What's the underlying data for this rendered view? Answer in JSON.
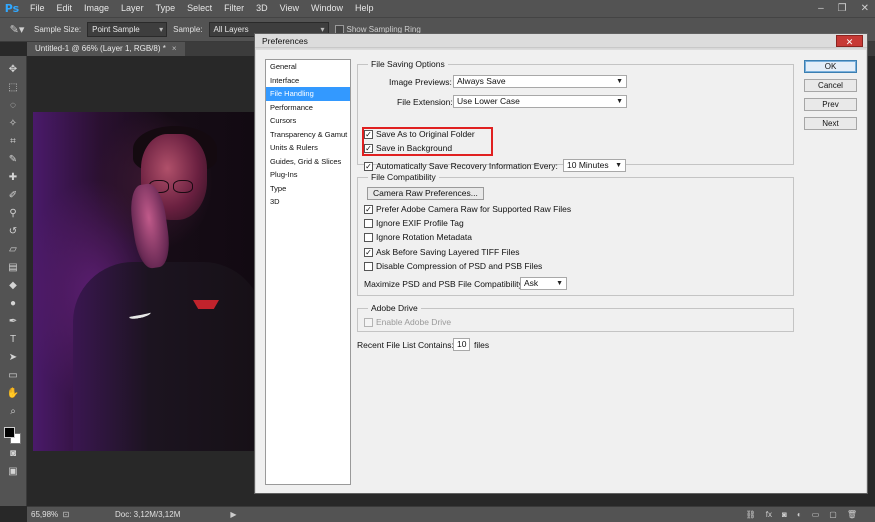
{
  "app": {
    "logo": "Ps",
    "menu": [
      "File",
      "Edit",
      "Image",
      "Layer",
      "Type",
      "Select",
      "Filter",
      "3D",
      "View",
      "Window",
      "Help"
    ],
    "window_controls": [
      "–",
      "❐",
      "✕"
    ]
  },
  "options_bar": {
    "sample_size_label": "Sample Size:",
    "sample_size_value": "Point Sample",
    "sample_label": "Sample:",
    "sample_value": "All Layers",
    "show_ring_label": "Show Sampling Ring"
  },
  "document_tab": {
    "title": "Untitled-1 @ 66% (Layer 1, RGB/8) *",
    "close": "×"
  },
  "status_bar": {
    "zoom": "65,98%",
    "doc_info": "Doc: 3,12M/3,12M",
    "arrow": "▶"
  },
  "preferences": {
    "title": "Preferences",
    "close_glyph": "✕",
    "categories": [
      {
        "label": "General",
        "selected": false
      },
      {
        "label": "Interface",
        "selected": false
      },
      {
        "label": "File Handling",
        "selected": true
      },
      {
        "label": "Performance",
        "selected": false
      },
      {
        "label": "Cursors",
        "selected": false
      },
      {
        "label": "Transparency & Gamut",
        "selected": false
      },
      {
        "label": "Units & Rulers",
        "selected": false
      },
      {
        "label": "Guides, Grid & Slices",
        "selected": false
      },
      {
        "label": "Plug-Ins",
        "selected": false
      },
      {
        "label": "Type",
        "selected": false
      },
      {
        "label": "3D",
        "selected": false
      }
    ],
    "buttons": {
      "ok": "OK",
      "cancel": "Cancel",
      "prev": "Prev",
      "next": "Next"
    },
    "file_saving": {
      "legend": "File Saving Options",
      "image_previews_label": "Image Previews:",
      "image_previews_value": "Always Save",
      "file_extension_label": "File Extension:",
      "file_extension_value": "Use Lower Case",
      "save_original_folder": {
        "label": "Save As to Original Folder",
        "checked": true
      },
      "save_background": {
        "label": "Save in Background",
        "checked": true
      },
      "auto_save": {
        "label": "Automatically Save Recovery Information Every:",
        "checked": true
      },
      "auto_save_interval": "10 Minutes"
    },
    "file_compatibility": {
      "legend": "File Compatibility",
      "camera_raw_button": "Camera Raw Preferences...",
      "options": [
        {
          "label": "Prefer Adobe Camera Raw for Supported Raw Files",
          "checked": true
        },
        {
          "label": "Ignore EXIF Profile Tag",
          "checked": false
        },
        {
          "label": "Ignore Rotation Metadata",
          "checked": false
        },
        {
          "label": "Ask Before Saving Layered TIFF Files",
          "checked": true
        },
        {
          "label": "Disable Compression of PSD and PSB Files",
          "checked": false
        }
      ],
      "maximize_label": "Maximize PSD and PSB File Compatibility:",
      "maximize_value": "Ask"
    },
    "adobe_drive": {
      "legend": "Adobe Drive",
      "enable_label": "Enable Adobe Drive",
      "enabled": false
    },
    "recent_files": {
      "label": "Recent File List Contains:",
      "value": "10",
      "suffix": "files"
    }
  },
  "colors": {
    "selection": "#3399ff",
    "highlight": "#e02020",
    "close_button": "#c73a36",
    "ps_logo": "#31a8ff"
  }
}
